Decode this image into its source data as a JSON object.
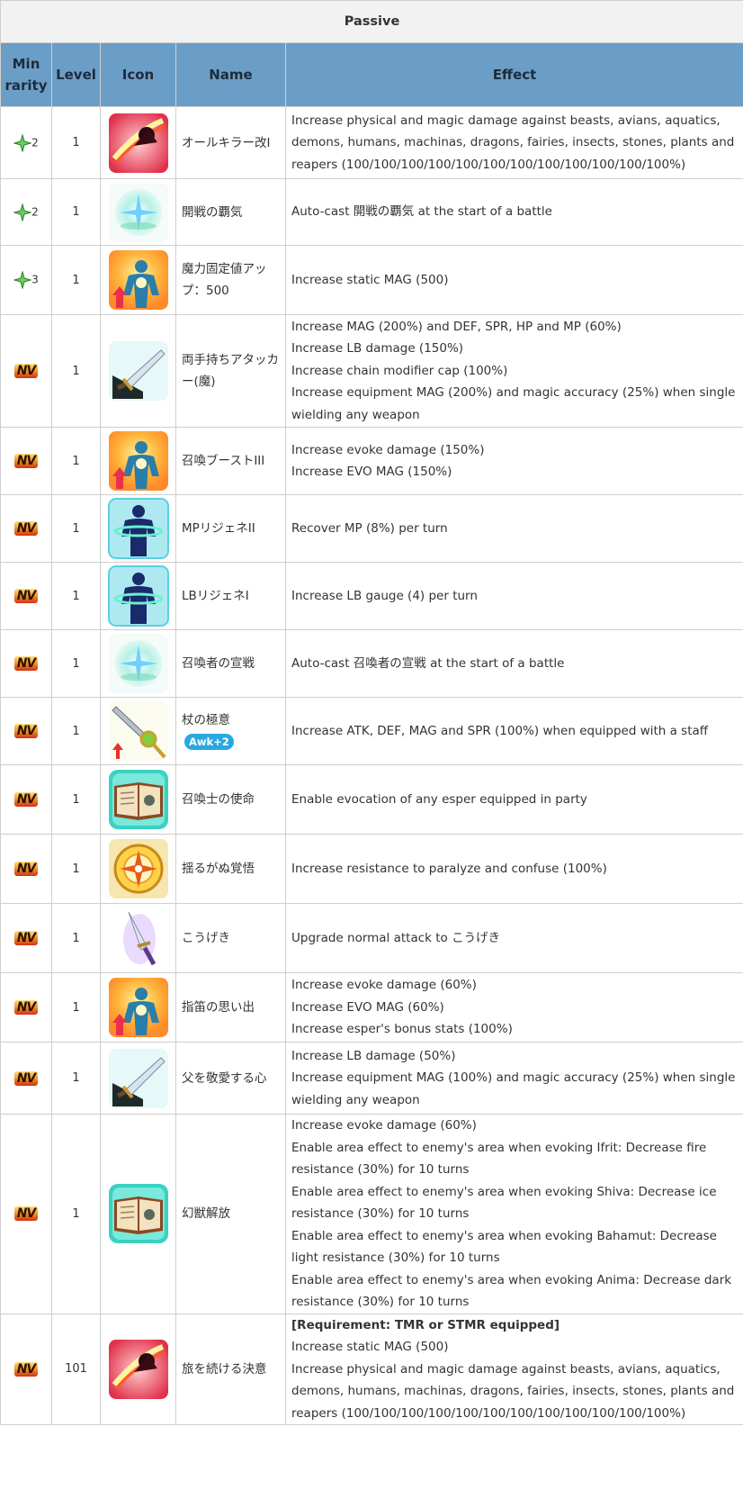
{
  "section_title": "Passive",
  "headers": [
    "Min rarity",
    "Level",
    "Icon",
    "Name",
    "Effect"
  ],
  "rows": [
    {
      "rarity": "2",
      "rarity_type": "star",
      "level": "1",
      "icon": "red-slash-icon",
      "name": "オールキラー改I",
      "name_badge": "",
      "effect": [
        "Increase physical and magic damage against beasts, avians, aquatics, demons, humans, machinas, dragons, fairies, insects, stones, plants and reapers (100/100/100/100/100/100/100/100/100/100/100/100%)"
      ]
    },
    {
      "rarity": "2",
      "rarity_type": "star",
      "level": "1",
      "icon": "sparkle-orb-icon",
      "name": "開戦の覇気",
      "name_badge": "",
      "effect": [
        "Auto-cast 開戦の覇気 at the start of a battle"
      ]
    },
    {
      "rarity": "3",
      "rarity_type": "star",
      "level": "1",
      "icon": "power-up-figure-icon",
      "name": "魔力固定値アップ：500",
      "name_badge": "",
      "effect": [
        "Increase static MAG (500)"
      ]
    },
    {
      "rarity": "NV",
      "rarity_type": "nv",
      "level": "1",
      "icon": "sword-icon",
      "name": "両手持ちアタッカー(魔)",
      "name_badge": "",
      "effect": [
        "Increase MAG (200%) and DEF, SPR, HP and MP (60%)",
        "Increase LB damage (150%)",
        "Increase chain modifier cap (100%)",
        "Increase equipment MAG (200%) and magic accuracy (25%) when single wielding any weapon"
      ]
    },
    {
      "rarity": "NV",
      "rarity_type": "nv",
      "level": "1",
      "icon": "power-up-figure-icon",
      "name": "召喚ブーストIII",
      "name_badge": "",
      "effect": [
        "Increase evoke damage (150%)",
        "Increase EVO MAG (150%)"
      ]
    },
    {
      "rarity": "NV",
      "rarity_type": "nv",
      "level": "1",
      "icon": "regen-figure-icon",
      "name": "MPリジェネII",
      "name_badge": "",
      "effect": [
        "Recover MP (8%) per turn"
      ]
    },
    {
      "rarity": "NV",
      "rarity_type": "nv",
      "level": "1",
      "icon": "regen-figure-icon",
      "name": "LBリジェネI",
      "name_badge": "",
      "effect": [
        "Increase LB gauge (4) per turn"
      ]
    },
    {
      "rarity": "NV",
      "rarity_type": "nv",
      "level": "1",
      "icon": "sparkle-orb-icon",
      "name": "召喚者の宣戦",
      "name_badge": "",
      "effect": [
        "Auto-cast 召喚者の宣戦 at the start of a battle"
      ]
    },
    {
      "rarity": "NV",
      "rarity_type": "nv",
      "level": "1",
      "icon": "staff-up-icon",
      "name": "杖の極意",
      "name_badge": "Awk+2",
      "effect": [
        "Increase ATK, DEF, MAG and SPR (100%) when equipped with a staff"
      ]
    },
    {
      "rarity": "NV",
      "rarity_type": "nv",
      "level": "1",
      "icon": "book-icon",
      "name": "召喚士の使命",
      "name_badge": "",
      "effect": [
        "Enable evocation of any esper equipped in party"
      ]
    },
    {
      "rarity": "NV",
      "rarity_type": "nv",
      "level": "1",
      "icon": "compass-icon",
      "name": "揺るがぬ覚悟",
      "name_badge": "",
      "effect": [
        "Increase resistance to paralyze and confuse (100%)"
      ]
    },
    {
      "rarity": "NV",
      "rarity_type": "nv",
      "level": "1",
      "icon": "dagger-icon",
      "name": "こうげき",
      "name_badge": "",
      "effect": [
        "Upgrade normal attack to こうげき"
      ]
    },
    {
      "rarity": "NV",
      "rarity_type": "nv",
      "level": "1",
      "icon": "power-up-figure-icon",
      "name": "指笛の思い出",
      "name_badge": "",
      "effect": [
        "Increase evoke damage (60%)",
        "Increase EVO MAG (60%)",
        "Increase esper's bonus stats (100%)"
      ]
    },
    {
      "rarity": "NV",
      "rarity_type": "nv",
      "level": "1",
      "icon": "sword-icon",
      "name": "父を敬愛する心",
      "name_badge": "",
      "effect": [
        "Increase LB damage (50%)",
        "Increase equipment MAG (100%) and magic accuracy (25%) when single wielding any weapon"
      ]
    },
    {
      "rarity": "NV",
      "rarity_type": "nv",
      "level": "1",
      "icon": "book-icon",
      "name": "幻獣解放",
      "name_badge": "",
      "effect": [
        "Increase evoke damage (60%)",
        "Enable area effect to enemy's area when evoking Ifrit: Decrease fire resistance (30%) for 10 turns",
        "Enable area effect to enemy's area when evoking Shiva: Decrease ice resistance (30%) for 10 turns",
        "Enable area effect to enemy's area when evoking Bahamut: Decrease light resistance (30%) for 10 turns",
        "Enable area effect to enemy's area when evoking Anima: Decrease dark resistance (30%) for 10 turns"
      ]
    },
    {
      "rarity": "NV",
      "rarity_type": "nv",
      "level": "101",
      "icon": "red-slash-icon",
      "name": "旅を続ける決意",
      "name_badge": "",
      "effect_bold": "[Requirement: TMR or STMR equipped]",
      "effect": [
        "Increase static MAG (500)",
        "Increase physical and magic damage against beasts, avians, aquatics, demons, humans, machinas, dragons, fairies, insects, stones, plants and reapers (100/100/100/100/100/100/100/100/100/100/100/100%)"
      ]
    }
  ]
}
